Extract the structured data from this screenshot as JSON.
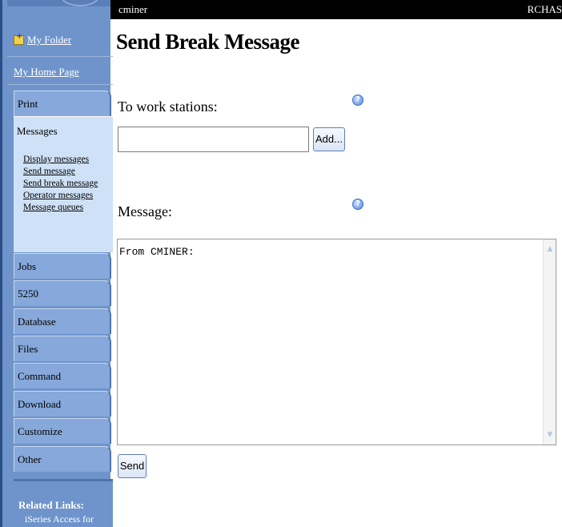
{
  "topbar": {
    "user": "cminer",
    "system": "RCHAS"
  },
  "nav": {
    "my_folder": "My Folder",
    "my_home_page": "My Home Page",
    "tabs": {
      "print": "Print",
      "messages": "Messages",
      "jobs": "Jobs",
      "t5250": "5250",
      "database": "Database",
      "files": "Files",
      "command": "Command",
      "download": "Download",
      "customize": "Customize",
      "other": "Other"
    },
    "messages_items": [
      "Display messages",
      "Send message",
      "Send break message",
      "Operator messages",
      "Message queues"
    ],
    "related_heading": "Related Links:",
    "related_link": "iSeries Access for Web"
  },
  "main": {
    "title": "Send Break Message",
    "workstations_label": "To work stations:",
    "workstations_value": "",
    "add_label": "Add...",
    "message_label": "Message:",
    "message_value": "From CMINER:",
    "send_label": "Send",
    "help_glyph": "?"
  },
  "colors": {
    "nav_bg": "#6f94cc",
    "active_section_bg": "#cfe1f6",
    "topbar_bg": "#000000"
  },
  "icons": {
    "folder": "folder-new-icon",
    "help": "help-icon",
    "scroll_up": "scroll-up-arrow-icon",
    "scroll_down": "scroll-down-arrow-icon"
  }
}
